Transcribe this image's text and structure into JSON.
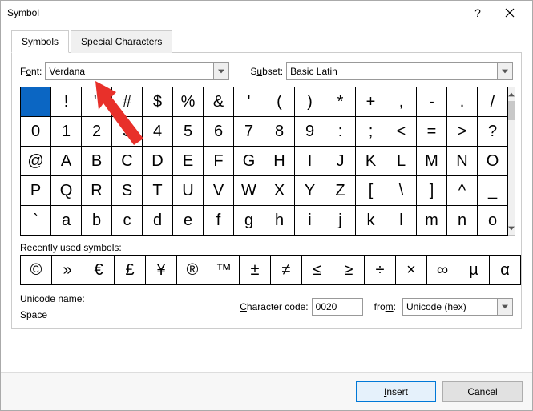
{
  "title": "Symbol",
  "tabs": {
    "symbols": "Symbols",
    "special": "Special Characters"
  },
  "font": {
    "label_pre": "F",
    "label_u": "o",
    "label_post": "nt:",
    "value": "Verdana"
  },
  "subset": {
    "label_pre": "S",
    "label_u": "u",
    "label_post": "bset:",
    "value": "Basic Latin"
  },
  "grid": [
    [
      " ",
      "!",
      "\"",
      "#",
      "$",
      "%",
      "&",
      "'",
      "(",
      ")",
      "*",
      "+",
      ",",
      "-",
      ".",
      "/"
    ],
    [
      "0",
      "1",
      "2",
      "3",
      "4",
      "5",
      "6",
      "7",
      "8",
      "9",
      ":",
      ";",
      "<",
      "=",
      ">",
      "?"
    ],
    [
      "@",
      "A",
      "B",
      "C",
      "D",
      "E",
      "F",
      "G",
      "H",
      "I",
      "J",
      "K",
      "L",
      "M",
      "N",
      "O"
    ],
    [
      "P",
      "Q",
      "R",
      "S",
      "T",
      "U",
      "V",
      "W",
      "X",
      "Y",
      "Z",
      "[",
      "\\",
      "]",
      "^",
      "_"
    ],
    [
      "`",
      "a",
      "b",
      "c",
      "d",
      "e",
      "f",
      "g",
      "h",
      "i",
      "j",
      "k",
      "l",
      "m",
      "n",
      "o"
    ]
  ],
  "recent_label_pre": "",
  "recent_label_u": "R",
  "recent_label_post": "ecently used symbols:",
  "recent": [
    "©",
    "»",
    "€",
    "£",
    "¥",
    "®",
    "™",
    "±",
    "≠",
    "≤",
    "≥",
    "÷",
    "×",
    "∞",
    "µ",
    "α"
  ],
  "unicode_name_label": "Unicode name:",
  "unicode_name_value": "Space",
  "char_code_label_u": "C",
  "char_code_label_post": "haracter code:",
  "char_code_value": "0020",
  "from_label_pre": "fro",
  "from_label_u": "m",
  "from_label_post": ":",
  "from_value": "Unicode (hex)",
  "buttons": {
    "insert_u": "I",
    "insert_post": "nsert",
    "cancel": "Cancel"
  }
}
